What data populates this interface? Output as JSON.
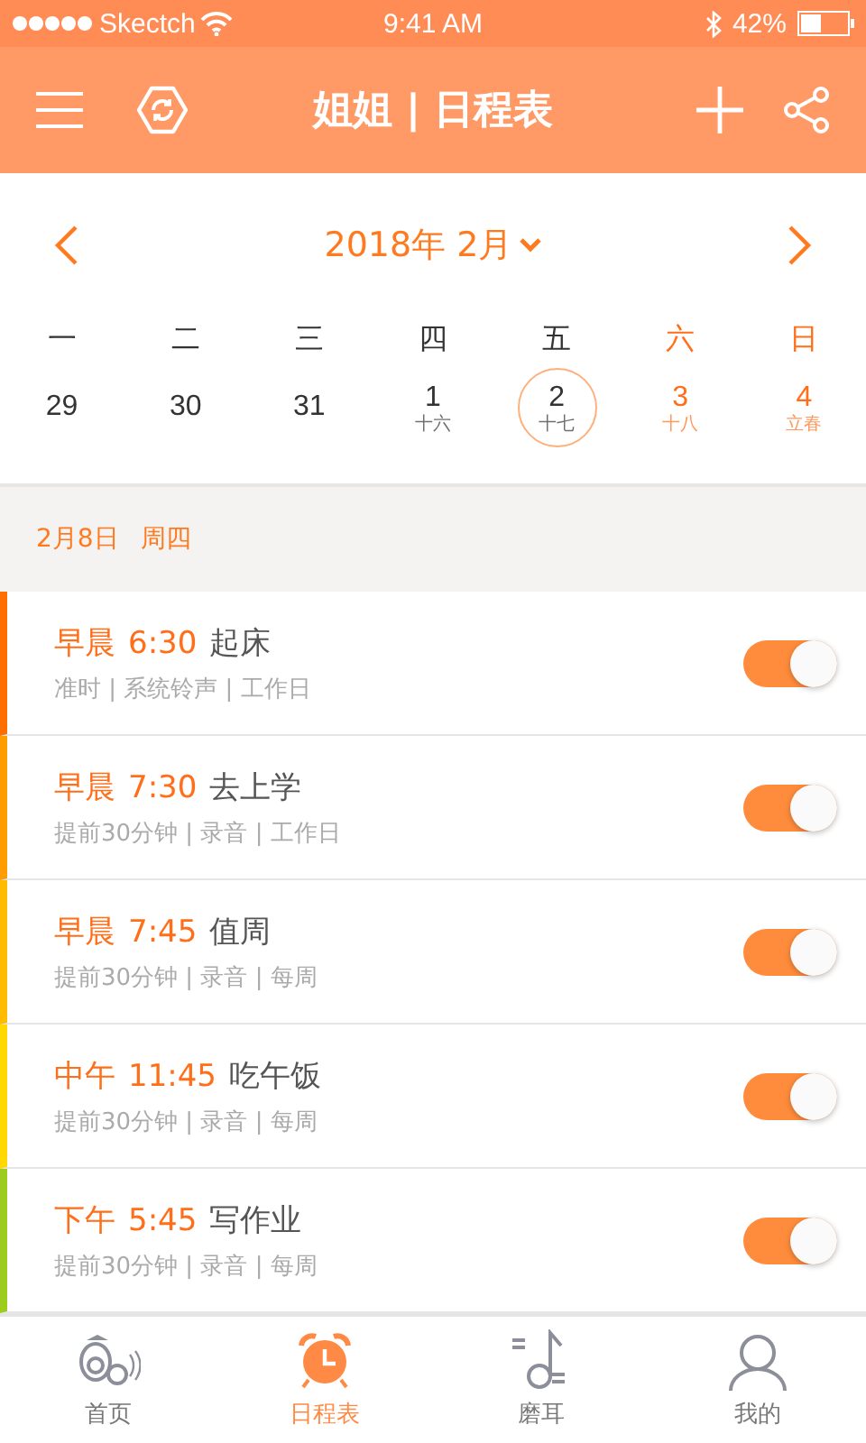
{
  "status_bar": {
    "carrier": "Skectch",
    "time": "9:41 AM",
    "battery": "42%"
  },
  "header": {
    "title": "姐姐 | 日程表"
  },
  "calendar": {
    "month": "2018年 2月",
    "weekdays": [
      {
        "label": "一",
        "weekend": false
      },
      {
        "label": "二",
        "weekend": false
      },
      {
        "label": "三",
        "weekend": false
      },
      {
        "label": "四",
        "weekend": false
      },
      {
        "label": "五",
        "weekend": false
      },
      {
        "label": "六",
        "weekend": true
      },
      {
        "label": "日",
        "weekend": true
      }
    ],
    "days": [
      {
        "number": "29",
        "weekend": false,
        "selected": false
      },
      {
        "number": "30",
        "weekend": false,
        "selected": false
      },
      {
        "number": "31",
        "weekend": false,
        "selected": false
      },
      {
        "number": "1",
        "lunar": "十六",
        "weekend": false,
        "selected": false
      },
      {
        "number": "2",
        "lunar": "十七",
        "weekend": false,
        "selected": true
      },
      {
        "number": "3",
        "lunar": "十八",
        "weekend": true,
        "selected": false
      },
      {
        "number": "4",
        "lunar": "立春",
        "weekend": true,
        "selected": false
      }
    ]
  },
  "date_header": {
    "date": "2月8日",
    "weekday": "周四"
  },
  "events": [
    {
      "period": "早晨",
      "time": "6:30",
      "title": "起床",
      "details": "准时 | 系统铃声 | 工作日",
      "color": "#ff6f00",
      "on": true
    },
    {
      "period": "早晨",
      "time": "7:30",
      "title": "去上学",
      "details": "提前30分钟 | 录音 | 工作日",
      "color": "#ff9c00",
      "on": true
    },
    {
      "period": "早晨",
      "time": "7:45",
      "title": "值周",
      "details": "提前30分钟 | 录音 | 每周",
      "color": "#ffbb00",
      "on": true
    },
    {
      "period": "中午",
      "time": "11:45",
      "title": "吃午饭",
      "details": "提前30分钟 | 录音 | 每周",
      "color": "#ffd800",
      "on": true
    },
    {
      "period": "下午",
      "time": "5:45",
      "title": "写作业",
      "details": "提前30分钟 | 录音 | 每周",
      "color": "#9ccc1c",
      "on": true
    }
  ],
  "tabs": [
    {
      "label": "首页",
      "kind": "home",
      "selected": false
    },
    {
      "label": "日程表",
      "kind": "clock",
      "selected": true
    },
    {
      "label": "磨耳",
      "kind": "music",
      "selected": false
    },
    {
      "label": "我的",
      "kind": "user",
      "selected": false
    }
  ]
}
